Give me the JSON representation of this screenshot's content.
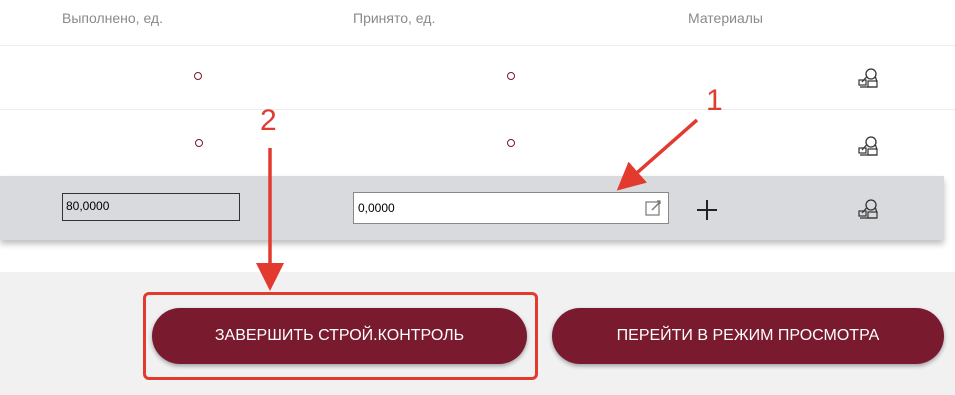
{
  "table": {
    "headers": {
      "done": "Выполнено, ед.",
      "accepted": "Принято, ед.",
      "materials": "Материалы"
    },
    "edit_row": {
      "done_value": "80,0000",
      "accepted_value": "0,0000"
    }
  },
  "footer": {
    "finish_button": "ЗАВЕРШИТЬ СТРОЙ.КОНТРОЛЬ",
    "view_mode_button": "ПЕРЕЙТИ В РЕЖИМ ПРОСМОТРА"
  },
  "annotations": {
    "callout_1": "1",
    "callout_2": "2"
  },
  "colors": {
    "accent": "#7a1a2e",
    "annotation": "#e23a2e",
    "row_highlight": "#d9dadd"
  },
  "icons": [
    "materials-icon",
    "edit-icon",
    "plus-icon",
    "status-dot-icon"
  ]
}
